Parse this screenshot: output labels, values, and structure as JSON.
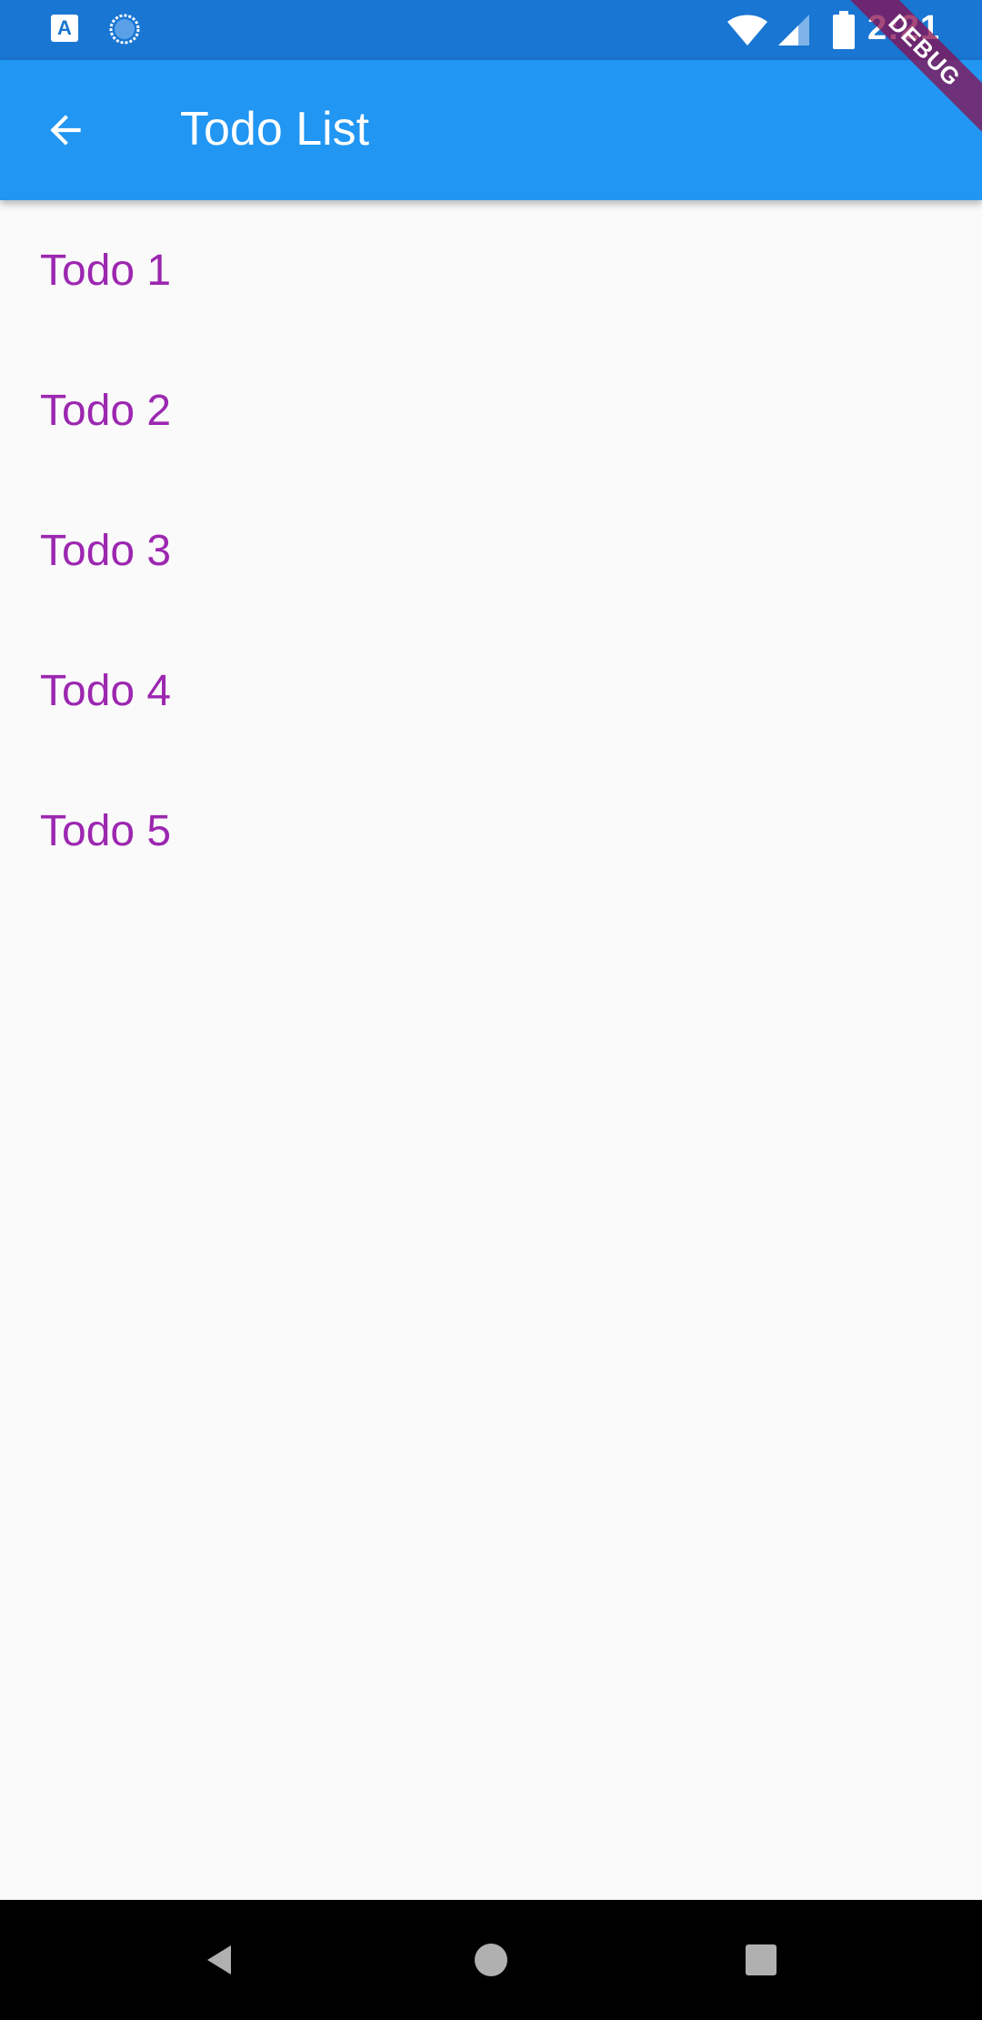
{
  "status_bar": {
    "time": "2:21",
    "left_icons": [
      "accessibility-icon",
      "sync-icon"
    ],
    "right_icons": [
      "wifi-icon",
      "cell-signal-icon",
      "battery-icon"
    ]
  },
  "app_bar": {
    "title": "Todo List",
    "back_icon": "arrow-back-icon",
    "background_color": "#2196f3"
  },
  "debug_banner": {
    "label": "DEBUG"
  },
  "todos": [
    {
      "title": "Todo 1"
    },
    {
      "title": "Todo 2"
    },
    {
      "title": "Todo 3"
    },
    {
      "title": "Todo 4"
    },
    {
      "title": "Todo 5"
    }
  ],
  "colors": {
    "status_bar": "#1976d2",
    "todo_text": "#9c27b0",
    "background": "#fafafa"
  },
  "nav_bar": {
    "buttons": [
      "nav-back-icon",
      "nav-home-icon",
      "nav-recents-icon"
    ]
  }
}
